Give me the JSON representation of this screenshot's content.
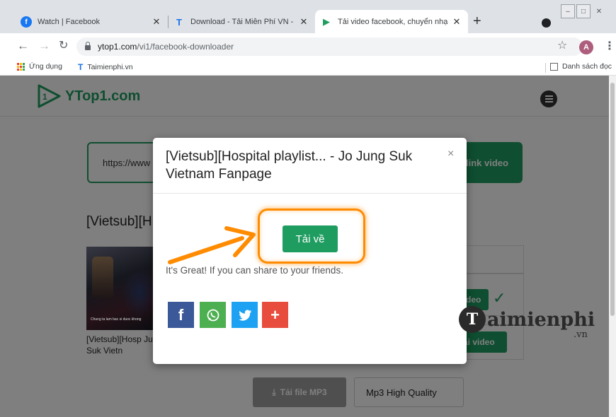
{
  "browser": {
    "tabs": [
      {
        "title": "Watch | Facebook",
        "favicon": "facebook-icon",
        "favicon_color": "#1877f2",
        "active": false
      },
      {
        "title": "Download - Tải Miễn Phí VN - Ph",
        "favicon": "taimienphi-icon",
        "favicon_color": "#1a73e8",
        "active": false
      },
      {
        "title": "Tải video facebook, chuyển nhạc",
        "favicon": "play-icon",
        "favicon_color": "#1f9d60",
        "active": true
      }
    ],
    "new_tab": "+",
    "url_host": "ytop1.com",
    "url_path": "/vi1/facebook-downloader",
    "profile_initial": "A",
    "bookmarks": [
      {
        "label": "Ứng dụng",
        "icon": "apps-grid-icon"
      },
      {
        "label": "Taimienphi.vn",
        "icon": "taimienphi-icon"
      }
    ],
    "reading_list": "Danh sách đọc"
  },
  "site": {
    "logo_text": "YTop1.com",
    "brand_color": "#1f9d60",
    "url_input_value": "https://www",
    "get_link_label": "link video",
    "video_title": "[Vietsub][H",
    "video_caption": "[Vietsub][Hosp Jung Suk Vietn",
    "thumb_caption": "Chung ta lam bac si duoc khong",
    "download_row1_label": "deo",
    "download_row2_label": "ải video",
    "mp3_button": "Tải file MP3",
    "mp3_quality": "Mp3 High Quality"
  },
  "modal": {
    "title": "[Vietsub][Hospital playlist... - Jo Jung Suk Vietnam Fanpage",
    "close": "×",
    "download_button": "Tải về",
    "share_text": "It's Great! If you can share to your friends.",
    "share_buttons": [
      {
        "label": "f",
        "icon": "facebook-icon",
        "color": "#3b5998"
      },
      {
        "label": "whatsapp",
        "icon": "whatsapp-icon",
        "color": "#4caf50"
      },
      {
        "label": "twitter",
        "icon": "twitter-icon",
        "color": "#1da1f2"
      },
      {
        "label": "+",
        "icon": "plus-icon",
        "color": "#e74c3c"
      }
    ],
    "highlight_color": "#ff8b00"
  },
  "watermark": {
    "letter": "T",
    "text": "aimienphi",
    "suffix": ".vn"
  }
}
